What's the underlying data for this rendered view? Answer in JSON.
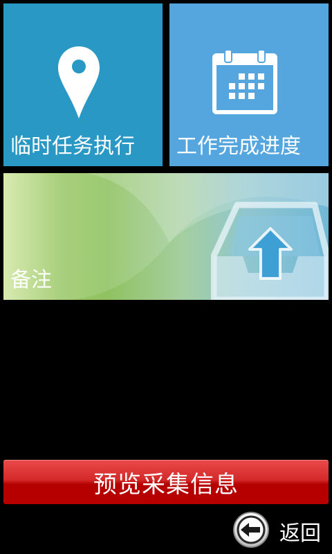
{
  "tiles": {
    "temporary_task": {
      "label": "临时任务执行",
      "icon": "map-pin-icon",
      "color": "#2a98c4"
    },
    "work_progress": {
      "label": "工作完成进度",
      "icon": "calendar-icon",
      "color": "#55a6de"
    },
    "notes": {
      "label": "备注",
      "icon": "upload-tray-icon"
    }
  },
  "actions": {
    "preview_label": "预览采集信息",
    "preview_color": "#c40000",
    "back_label": "返回",
    "back_icon": "back-arrow-icon"
  }
}
